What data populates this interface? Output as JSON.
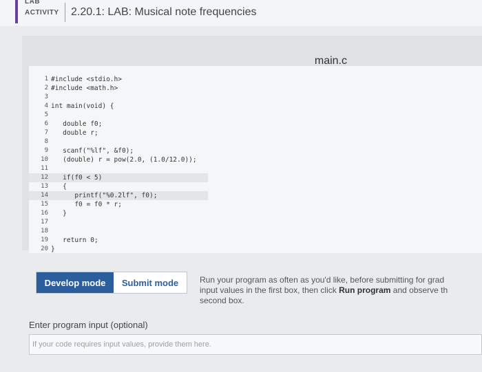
{
  "header": {
    "tag_line1": "LAB",
    "tag_line2": "ACTIVITY",
    "title": "2.20.1: LAB: Musical note frequencies"
  },
  "editor": {
    "filename": "main.c",
    "lines": [
      {
        "n": "1",
        "code": "#include <stdio.h>"
      },
      {
        "n": "2",
        "code": "#include <math.h>"
      },
      {
        "n": "3",
        "code": ""
      },
      {
        "n": "4",
        "code": "int main(void) {"
      },
      {
        "n": "5",
        "code": ""
      },
      {
        "n": "6",
        "code": "   double f0;"
      },
      {
        "n": "7",
        "code": "   double r;"
      },
      {
        "n": "8",
        "code": ""
      },
      {
        "n": "9",
        "code": "   scanf(\"%lf\", &f0);"
      },
      {
        "n": "10",
        "code": "   (double) r = pow(2.0, (1.0/12.0));"
      },
      {
        "n": "11",
        "code": ""
      },
      {
        "n": "12",
        "code": "   if(f0 < 5)"
      },
      {
        "n": "13",
        "code": "   {"
      },
      {
        "n": "14",
        "code": "      printf(\"%0.2lf\", f0);"
      },
      {
        "n": "15",
        "code": "      f0 = f0 * r;"
      },
      {
        "n": "16",
        "code": "   }"
      },
      {
        "n": "17",
        "code": ""
      },
      {
        "n": "18",
        "code": ""
      },
      {
        "n": "19",
        "code": "   return 0;"
      },
      {
        "n": "20",
        "code": "}"
      }
    ]
  },
  "modes": {
    "develop_label": "Develop mode",
    "submit_label": "Submit mode"
  },
  "run_info": {
    "text1": "Run your program as often as you'd like, before submitting for grad",
    "text2a": "input values in the first box, then click ",
    "text2b": "Run program",
    "text2c": " and observe th",
    "text3": "second box."
  },
  "program_input": {
    "label": "Enter program input (optional)",
    "placeholder": "If your code requires input values, provide them here."
  },
  "colors": {
    "accent": "#2c5e9e",
    "tag_bar": "#6a3fa0"
  }
}
